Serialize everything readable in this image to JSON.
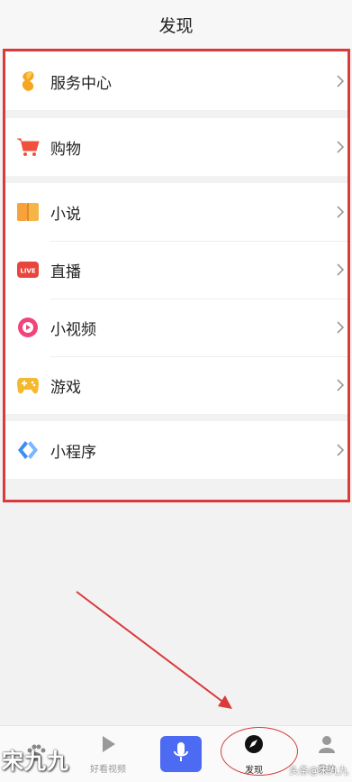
{
  "header": {
    "title": "发现"
  },
  "menu": {
    "groups": [
      {
        "items": [
          {
            "label": "服务中心",
            "icon": "service-center-icon"
          }
        ]
      },
      {
        "items": [
          {
            "label": "购物",
            "icon": "shopping-cart-icon"
          }
        ]
      },
      {
        "items": [
          {
            "label": "小说",
            "icon": "novel-book-icon"
          },
          {
            "label": "直播",
            "icon": "live-icon",
            "badge": "LIVE"
          },
          {
            "label": "小视频",
            "icon": "short-video-icon"
          },
          {
            "label": "游戏",
            "icon": "game-controller-icon"
          }
        ]
      },
      {
        "items": [
          {
            "label": "小程序",
            "icon": "mini-program-icon"
          }
        ]
      }
    ]
  },
  "tabbar": {
    "tabs": [
      {
        "label": "",
        "icon": "home-paw-icon"
      },
      {
        "label": "好看视频",
        "icon": "video-play-icon"
      },
      {
        "label": "",
        "icon": "microphone-icon"
      },
      {
        "label": "发现",
        "icon": "compass-icon",
        "active": true
      },
      {
        "label": "我的",
        "icon": "user-icon"
      }
    ]
  },
  "watermarks": {
    "left": "宋九九",
    "right": "头条@宋九九"
  },
  "colors": {
    "accent_blue": "#4d6af2",
    "annotation_red": "#d93a3a"
  }
}
